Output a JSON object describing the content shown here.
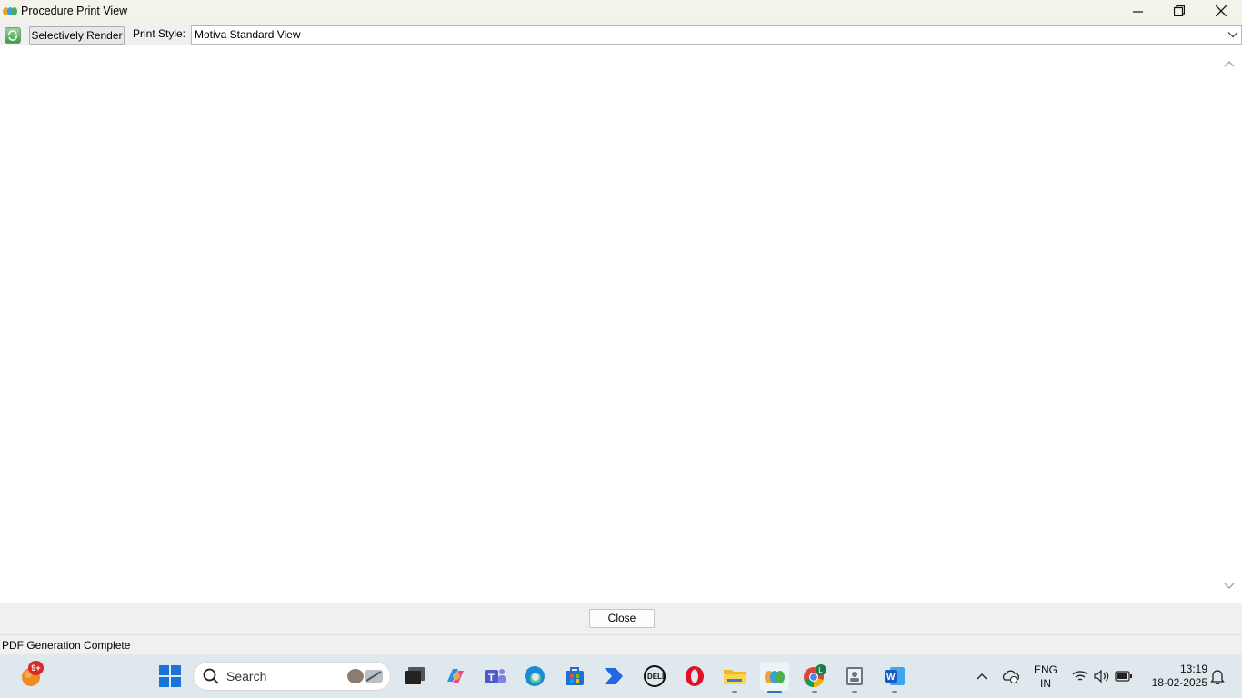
{
  "window": {
    "title": "Procedure Print View"
  },
  "toolbar": {
    "selectively_render_label": "Selectively Render",
    "print_style_label": "Print Style:",
    "print_style_value": "Motiva Standard View"
  },
  "footer": {
    "close_label": "Close"
  },
  "status": {
    "text": "PDF Generation Complete"
  },
  "taskbar": {
    "search_placeholder": "Search",
    "notification_badge": "9+",
    "chrome_profile_letter": "L",
    "language_line1": "ENG",
    "language_line2": "IN",
    "time": "13:19",
    "date": "18-02-2025",
    "pinned_icons": [
      "weather-icon",
      "start-icon",
      "search-icon",
      "task-view-icon",
      "copilot-icon",
      "teams-icon",
      "edge-icon",
      "store-icon",
      "power-automate-icon",
      "dell-icon",
      "opera-icon",
      "file-explorer-icon",
      "procedure-app-icon",
      "chrome-icon",
      "contacts-app-icon",
      "word-icon"
    ]
  },
  "colors": {
    "title_bar_bg": "#f3f3e9",
    "taskbar_bg": "#dfe8ec",
    "accent": "#2a6fc9"
  }
}
